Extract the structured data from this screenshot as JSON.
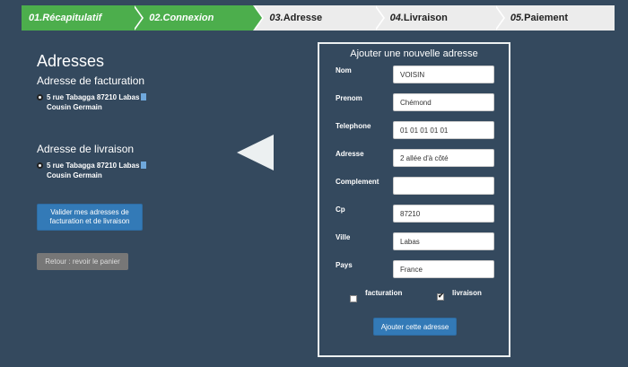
{
  "steps": [
    {
      "num": "01.",
      "label": "Récapitulatif"
    },
    {
      "num": "02.",
      "label": "Connexion"
    },
    {
      "num": "03.",
      "label": "Adresse"
    },
    {
      "num": "04.",
      "label": "Livraison"
    },
    {
      "num": "05.",
      "label": "Paiement"
    }
  ],
  "left": {
    "title": "Adresses",
    "billing_title": "Adresse de facturation",
    "billing_line1": "5 rue Tabagga 87210 Labas",
    "billing_line2": "Cousin Germain",
    "delivery_title": "Adresse de livraison",
    "delivery_line1": "5 rue Tabagga 87210 Labas",
    "delivery_line2": "Cousin Germain",
    "validate_button": "Valider mes adresses de facturation et de livraison",
    "back_button": "Retour : revoir le panier"
  },
  "form": {
    "title": "Ajouter une nouvelle adresse",
    "fields": {
      "nom": {
        "label": "Nom",
        "value": "VOISIN"
      },
      "prenom": {
        "label": "Prenom",
        "value": "Chémond"
      },
      "telephone": {
        "label": "Telephone",
        "value": "01 01 01 01 01"
      },
      "adresse": {
        "label": "Adresse",
        "value": "2 allée d'à côté"
      },
      "complement": {
        "label": "Complement",
        "value": ""
      },
      "cp": {
        "label": "Cp",
        "value": "87210"
      },
      "ville": {
        "label": "Ville",
        "value": "Labas"
      },
      "pays": {
        "label": "Pays",
        "value": "France"
      }
    },
    "facturation_label": "facturation",
    "livraison_label": "livraison",
    "submit_button": "Ajouter cette adresse"
  },
  "colors": {
    "background": "#34495e",
    "step_done": "#4cae4c",
    "primary": "#337ab7"
  },
  "icons": [
    "trash-icon",
    "back-arrow-icon",
    "checkbox-icon"
  ]
}
